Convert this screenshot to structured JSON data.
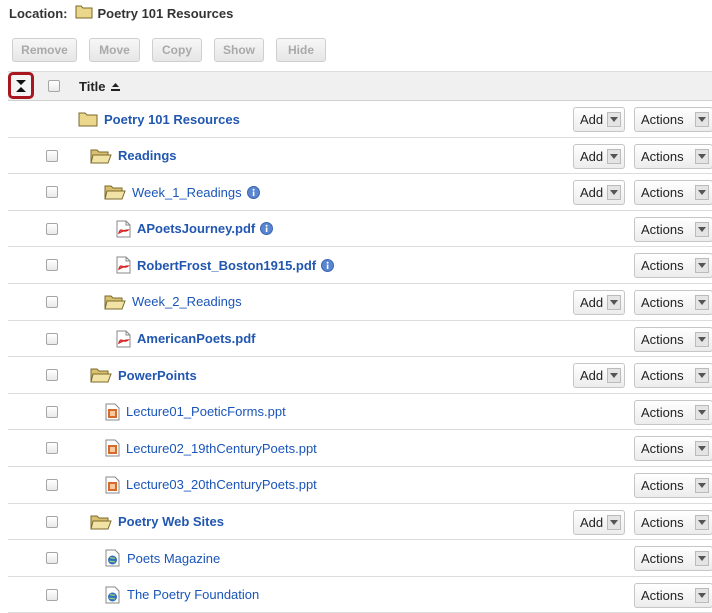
{
  "location": {
    "label": "Location:",
    "value": "Poetry 101 Resources"
  },
  "toolbar": {
    "remove": "Remove",
    "move": "Move",
    "copy": "Copy",
    "show": "Show",
    "hide": "Hide"
  },
  "header": {
    "title": "Title",
    "collapse_icon": "collapse-all-icon",
    "sort_icon": "sort-ascending-icon"
  },
  "dropdowns": {
    "add": "Add",
    "actions": "Actions"
  },
  "colors": {
    "link": "#1a55b8",
    "highlight_border": "#a8161f",
    "header_bg": "#f0f0f0",
    "folder": "#e9d589"
  },
  "rows": [
    {
      "name": "Poetry 101 Resources",
      "icon": "folder-closed-icon",
      "bold": true,
      "info": false,
      "checkbox": false,
      "add": true,
      "actions": true
    },
    {
      "name": "Readings",
      "icon": "folder-open-icon",
      "bold": true,
      "info": false,
      "checkbox": true,
      "add": true,
      "actions": true
    },
    {
      "name": "Week_1_Readings",
      "icon": "folder-open-icon",
      "bold": false,
      "info": true,
      "checkbox": true,
      "add": true,
      "actions": true
    },
    {
      "name": "APoetsJourney.pdf",
      "icon": "pdf-icon",
      "bold": true,
      "info": true,
      "checkbox": true,
      "add": false,
      "actions": true
    },
    {
      "name": "RobertFrost_Boston1915.pdf",
      "icon": "pdf-icon",
      "bold": true,
      "info": true,
      "checkbox": true,
      "add": false,
      "actions": true
    },
    {
      "name": "Week_2_Readings",
      "icon": "folder-open-icon",
      "bold": false,
      "info": false,
      "checkbox": true,
      "add": true,
      "actions": true
    },
    {
      "name": "AmericanPoets.pdf",
      "icon": "pdf-icon",
      "bold": true,
      "info": false,
      "checkbox": true,
      "add": false,
      "actions": true
    },
    {
      "name": "PowerPoints",
      "icon": "folder-open-icon",
      "bold": true,
      "info": false,
      "checkbox": true,
      "add": true,
      "actions": true
    },
    {
      "name": "Lecture01_PoeticForms.ppt",
      "icon": "ppt-icon",
      "bold": false,
      "info": false,
      "checkbox": true,
      "add": false,
      "actions": true
    },
    {
      "name": "Lecture02_19thCenturyPoets.ppt",
      "icon": "ppt-icon",
      "bold": false,
      "info": false,
      "checkbox": true,
      "add": false,
      "actions": true
    },
    {
      "name": "Lecture03_20thCenturyPoets.ppt",
      "icon": "ppt-icon",
      "bold": false,
      "info": false,
      "checkbox": true,
      "add": false,
      "actions": true
    },
    {
      "name": "Poetry Web Sites",
      "icon": "folder-open-icon",
      "bold": true,
      "info": false,
      "checkbox": true,
      "add": true,
      "actions": true
    },
    {
      "name": "Poets Magazine",
      "icon": "web-link-icon",
      "bold": false,
      "info": false,
      "checkbox": true,
      "add": false,
      "actions": true
    },
    {
      "name": "The Poetry Foundation",
      "icon": "web-link-icon",
      "bold": false,
      "info": false,
      "checkbox": true,
      "add": false,
      "actions": true
    }
  ]
}
